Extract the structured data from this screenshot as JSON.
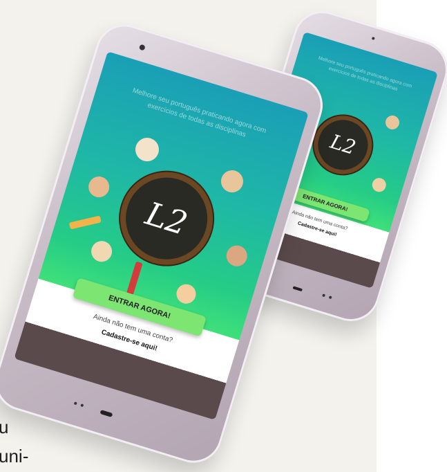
{
  "side_text": {
    "line1": "u",
    "line2": "uni-"
  },
  "app": {
    "tagline": "Melhore seu português praticando agora com exercícios de todas as disciplinas",
    "logo": "L2",
    "enter_button": "ENTRAR AGORA!",
    "no_account": "Ainda não tem uma conta?",
    "signup_link": "Cadastre-se aqui!"
  },
  "colors": {
    "gradient_top": "#1a9fb6",
    "gradient_bottom": "#3fe07a",
    "button": "#7de673",
    "chalkboard": "#2a2a25",
    "frame": "#6b4724"
  },
  "icons": [
    "chalkboard-logo",
    "character-avatar",
    "pencil-icon",
    "marker-icon"
  ]
}
